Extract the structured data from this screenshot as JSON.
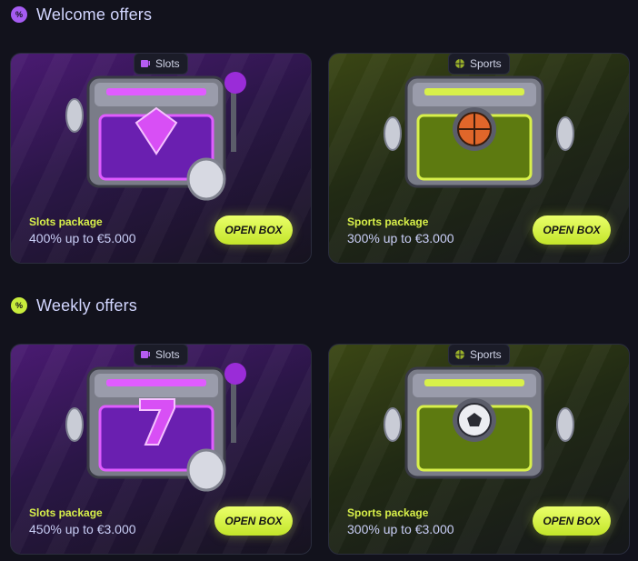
{
  "welcome": {
    "title": "Welcome offers",
    "cards": [
      {
        "tag": "Slots",
        "package": "Slots package",
        "offer": "400% up to €5.000",
        "button": "OPEN BOX"
      },
      {
        "tag": "Sports",
        "package": "Sports package",
        "offer": "300% up to €3.000",
        "button": "OPEN BOX"
      }
    ]
  },
  "weekly": {
    "title": "Weekly offers",
    "cards": [
      {
        "tag": "Slots",
        "package": "Slots package",
        "offer": "450% up to €3.000",
        "button": "OPEN BOX"
      },
      {
        "tag": "Sports",
        "package": "Sports package",
        "offer": "300% up to €3.000",
        "button": "OPEN BOX"
      }
    ]
  },
  "colors": {
    "accent_green": "#c8ec3c",
    "accent_purple": "#a65cf2",
    "background": "#12121c",
    "offer_text": "#c9cef6"
  },
  "icons": {
    "welcome_badge": "percent-badge-icon",
    "weekly_badge": "percent-badge-icon",
    "slots_tag": "slot-machine-icon",
    "sports_tag": "ball-icon"
  }
}
